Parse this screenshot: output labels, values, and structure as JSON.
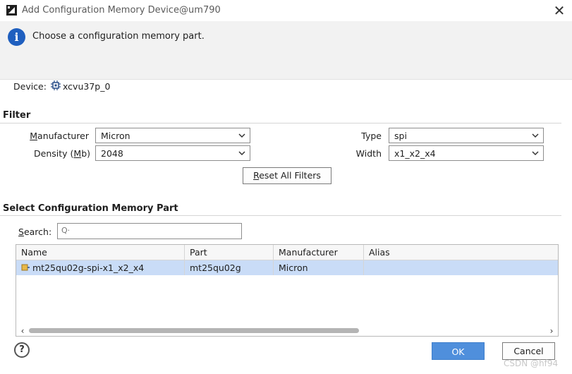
{
  "window": {
    "title": "Add Configuration Memory Device@um790",
    "close_glyph": "✕"
  },
  "banner": {
    "message": "Choose a configuration memory part."
  },
  "device": {
    "label": "Device:",
    "name": "xcvu37p_0"
  },
  "filter": {
    "section_title": "Filter",
    "manufacturer": {
      "label_pre": "",
      "label_u": "M",
      "label_post": "anufacturer",
      "value": "Micron"
    },
    "density": {
      "label_pre": "Density (",
      "label_u": "M",
      "label_post": "b)",
      "value": "2048"
    },
    "type": {
      "label": "Type",
      "value": "spi"
    },
    "width": {
      "label": "Width",
      "value": "x1_x2_x4"
    },
    "reset_button": {
      "label_u": "R",
      "label_post": "eset All Filters"
    }
  },
  "select_section": {
    "title": "Select Configuration Memory Part",
    "search": {
      "label_u": "S",
      "label_post": "earch:",
      "placeholder": "Q·"
    },
    "table": {
      "columns": [
        "Name",
        "Part",
        "Manufacturer",
        "Alias"
      ],
      "rows": [
        {
          "name": "mt25qu02g-spi-x1_x2_x4",
          "part": "mt25qu02g",
          "manufacturer": "Micron",
          "alias": ""
        }
      ]
    }
  },
  "footer": {
    "help": "?",
    "ok": "OK",
    "cancel": "Cancel"
  },
  "watermark": "CSDN @hf94",
  "colors": {
    "accent": "#4f8fdc",
    "selection": "#c9dcf7",
    "info": "#1f5fbf"
  }
}
